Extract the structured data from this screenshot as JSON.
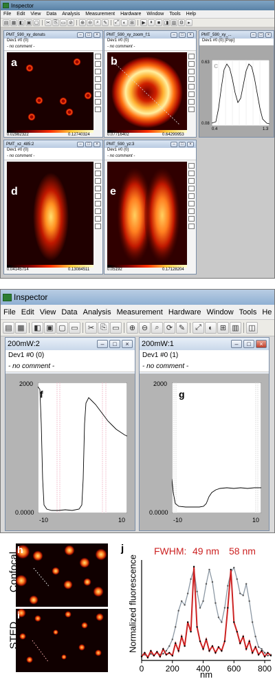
{
  "top_window": {
    "title": "Inspector",
    "menu": [
      "File",
      "Edit",
      "View",
      "Data",
      "Analysis",
      "Measurement",
      "Hardware",
      "Window",
      "Tools",
      "Help"
    ],
    "panels": {
      "a": {
        "title": "PMT_590_xy_donuts",
        "info": "Dev1 #0 (0)",
        "note": "- no comment -",
        "letter": "a",
        "cmin": "0.02982322",
        "cmax": "0.12740324"
      },
      "b": {
        "title": "PMT_590_xy_zoom_f:1",
        "info": "Dev1 #0 (0)",
        "note": "- no comment -",
        "letter": "b",
        "cmin": "0.07716402",
        "cmax": "0.64299953"
      },
      "c": {
        "title": "PMT_590_xy_...",
        "info": "Dev1 #0 (0) [Pop]",
        "letter": "c",
        "ymax": "0.63",
        "ymin": "0.08",
        "xmin": "0.4",
        "xmax": "1.3"
      },
      "d": {
        "title": "PMT_xz_485:2",
        "info": "Dev1 #0 (0)",
        "note": "- no comment -",
        "letter": "d",
        "cmin": "0.04145714",
        "cmax": "0.13084511"
      },
      "e": {
        "title": "PMT_590_yz:3",
        "info": "Dev1 #0 (0)",
        "note": "- no comment -",
        "letter": "e",
        "cmin": "0.05192",
        "cmax": "0.17128204"
      }
    }
  },
  "bottom_window": {
    "title": "Inspector",
    "menu": [
      "File",
      "Edit",
      "View",
      "Data",
      "Analysis",
      "Measurement",
      "Hardware",
      "Window",
      "Tools",
      "He"
    ],
    "panels": {
      "f": {
        "title": "200mW:2",
        "info": "Dev1 #0 (0)",
        "note": "- no comment -",
        "letter": "f",
        "ymax": "2000",
        "ymin": "0.0000",
        "xmin": "-10",
        "xmax": "10"
      },
      "g": {
        "title": "200mW:1",
        "info": "Dev1 #0 (1)",
        "note": "- no comment -",
        "letter": "g",
        "ymax": "2000",
        "ymin": "0.0000",
        "xmin": "-10",
        "xmax": "10"
      }
    }
  },
  "figure": {
    "h_letter": "h",
    "i_letter": "i",
    "j_letter": "j",
    "confocal_label": "Confocal",
    "sted_label": "STED",
    "fwhm_label": "FWHM:",
    "fwhm_1": "49 nm",
    "fwhm_2": "58 nm",
    "colors": {
      "sted": "#cc2222",
      "confocal": "#8c98a4"
    }
  },
  "chart_data": {
    "type": "line",
    "xlabel": "nm",
    "ylabel": "Normalized fluorescence",
    "xlim": [
      0,
      840
    ],
    "x_ticks": [
      "0",
      "200",
      "400",
      "600",
      "800"
    ],
    "ylim": [
      0,
      1.05
    ],
    "series": [
      {
        "values_x": [
          0,
          20,
          40,
          60,
          80,
          100,
          120,
          140,
          160,
          180,
          200,
          220,
          240,
          260,
          280,
          300,
          320,
          340,
          360,
          380,
          400,
          420,
          440,
          460,
          480,
          500,
          520,
          540,
          560,
          580,
          600,
          620,
          640,
          660,
          680,
          700,
          720,
          740,
          760,
          780,
          800,
          820,
          840
        ],
        "values": [
          0.05,
          0.06,
          0.04,
          0.07,
          0.05,
          0.08,
          0.06,
          0.07,
          0.1,
          0.15,
          0.22,
          0.35,
          0.52,
          0.62,
          0.58,
          0.7,
          0.85,
          0.95,
          0.72,
          0.55,
          0.62,
          0.8,
          0.95,
          0.82,
          0.6,
          0.45,
          0.4,
          0.55,
          0.78,
          0.92,
          0.97,
          0.85,
          0.7,
          0.68,
          0.8,
          0.62,
          0.4,
          0.25,
          0.14,
          0.12,
          0.08,
          0.05,
          0.06
        ]
      },
      {
        "values_x": [
          0,
          20,
          40,
          60,
          80,
          100,
          120,
          140,
          160,
          180,
          200,
          220,
          240,
          260,
          280,
          300,
          320,
          340,
          360,
          380,
          400,
          420,
          440,
          460,
          480,
          500,
          520,
          540,
          560,
          580,
          600,
          620,
          640,
          660,
          680,
          700,
          720,
          740,
          760,
          780,
          800,
          820,
          840
        ],
        "values": [
          0.04,
          0.08,
          0.03,
          0.1,
          0.05,
          0.09,
          0.04,
          0.12,
          0.06,
          0.08,
          0.05,
          0.18,
          0.1,
          0.25,
          0.15,
          0.4,
          0.3,
          0.98,
          0.35,
          0.2,
          0.12,
          0.22,
          0.1,
          0.15,
          0.08,
          0.14,
          0.1,
          0.2,
          0.55,
          0.95,
          0.4,
          0.3,
          0.18,
          0.25,
          0.12,
          0.2,
          0.08,
          0.14,
          0.06,
          0.1,
          0.04,
          0.08,
          0.05
        ]
      }
    ]
  }
}
